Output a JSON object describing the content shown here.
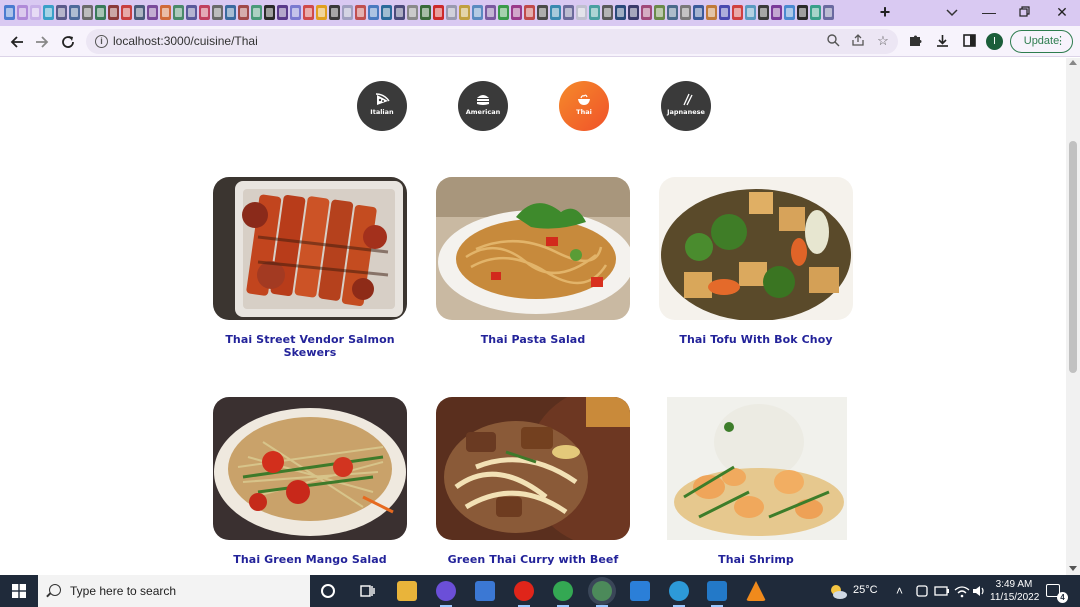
{
  "browser": {
    "url": "localhost:3000/cuisine/Thai",
    "update_label": "Update",
    "profile_initial": "I",
    "tab_colors": [
      "#4a7bd0",
      "#b08ad8",
      "#c7b0e8",
      "#3aa0c8",
      "#5b5b8a",
      "#4d6a9a",
      "#6b6b6b",
      "#3a7a5a",
      "#8a3a3a",
      "#c84040",
      "#4a5a7a",
      "#7a4a9a",
      "#d06a3a",
      "#4a8a6a",
      "#5a5a9a",
      "#c04060",
      "#6a6a6a",
      "#3a6aa0",
      "#a04a4a",
      "#4a9a7a",
      "#2a2a2a",
      "#5a3a8a",
      "#7a7ad0",
      "#d04a4a",
      "#e0a020",
      "#3a3a3a",
      "#a0a0c0",
      "#c05050",
      "#4a7ac0",
      "#2a6a9a",
      "#4a4a7a",
      "#8a8a8a",
      "#3a6a3a",
      "#cc2a2a",
      "#9a9ab0",
      "#c0a040",
      "#5a8ac0",
      "#7a5aa0",
      "#3a9a4a",
      "#9a3a8a",
      "#c04a4a",
      "#4a4a4a",
      "#3a8ab0",
      "#6a6a9a",
      "#c0c0d0",
      "#4aa0a0",
      "#5a5a5a",
      "#2a4a7a",
      "#3a3a6a",
      "#a04a7a",
      "#6a8a4a",
      "#4a6a8a",
      "#7a7a7a",
      "#3a5a9a",
      "#c07a3a",
      "#4a4ab0",
      "#d04040",
      "#5a9ac0",
      "#3a3a3a",
      "#7a3a9a",
      "#4a8ad0",
      "#2a2a2a",
      "#3aa08a",
      "#6a6aa0"
    ]
  },
  "categories": [
    {
      "label": "Italian",
      "icon": "pizza-icon",
      "active": false
    },
    {
      "label": "American",
      "icon": "burger-icon",
      "active": false
    },
    {
      "label": "Thai",
      "icon": "bowl-icon",
      "active": true
    },
    {
      "label": "Japnanese",
      "icon": "chopsticks-icon",
      "active": false
    }
  ],
  "recipes": [
    {
      "title": "Thai Street Vendor Salmon Skewers",
      "image": "salmon-skewers-photo"
    },
    {
      "title": "Thai Pasta Salad",
      "image": "pasta-salad-photo"
    },
    {
      "title": "Thai Tofu With Bok Choy",
      "image": "tofu-bok-choy-photo"
    },
    {
      "title": "Thai Green Mango Salad",
      "image": "green-mango-salad-photo"
    },
    {
      "title": "Green Thai Curry with Beef",
      "image": "green-curry-beef-photo"
    },
    {
      "title": "Thai Shrimp",
      "image": "thai-shrimp-photo"
    }
  ],
  "taskbar": {
    "search_placeholder": "Type here to search",
    "weather": "25°C",
    "time": "3:49 AM",
    "date": "11/15/2022",
    "notification_count": "4"
  }
}
